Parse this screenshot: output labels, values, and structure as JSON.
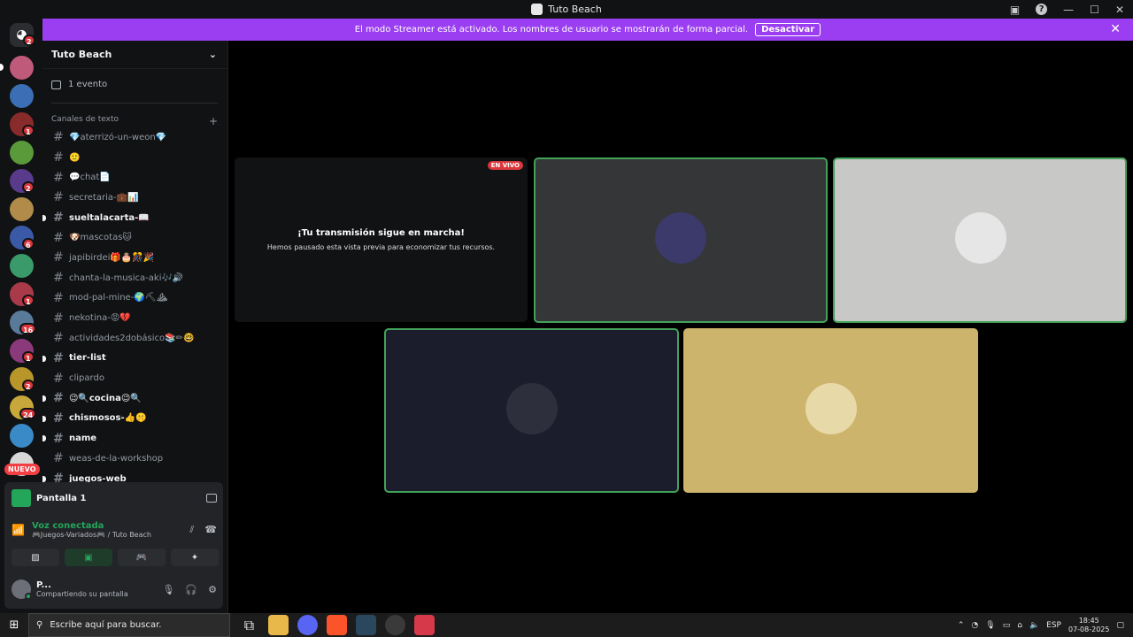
{
  "window": {
    "title": "Tuto Beach"
  },
  "banner": {
    "text": "El modo Streamer está activado. Los nombres de usuario se mostrarán de forma parcial.",
    "button": "Desactivar"
  },
  "rail": {
    "badges": [
      "2",
      "1",
      "2",
      "6",
      "1",
      "16",
      "1",
      "2",
      "24"
    ],
    "new_label": "NUEVO"
  },
  "server": {
    "name": "Tuto Beach",
    "events": "1 evento",
    "category": "Canales de texto",
    "channels": [
      {
        "name": "💎aterrizó-un-weon💎",
        "bold": false
      },
      {
        "name": "🙂",
        "bold": false
      },
      {
        "name": "💬chat📄",
        "bold": false
      },
      {
        "name": "secretaria-💼📊",
        "bold": false
      },
      {
        "name": "sueltalacarta-📖",
        "bold": true
      },
      {
        "name": "🐶mascotas🐱",
        "bold": false
      },
      {
        "name": "japibirdei🎁🎂🎊🎉",
        "bold": false
      },
      {
        "name": "chanta-la-musica-aki🎶🔊",
        "bold": false
      },
      {
        "name": "mod-pal-mine-🌍⛏⛰",
        "bold": false
      },
      {
        "name": "nekotina-😡💔",
        "bold": false
      },
      {
        "name": "actividades2dobásico📚✏🤓",
        "bold": false
      },
      {
        "name": "tier-list",
        "bold": true
      },
      {
        "name": "clipardo",
        "bold": false
      },
      {
        "name": "😉🔍cocina😉🔍",
        "bold": true
      },
      {
        "name": "chismosos-👍🤫",
        "bold": true
      },
      {
        "name": "name",
        "bold": true
      },
      {
        "name": "weas-de-la-workshop",
        "bold": false
      },
      {
        "name": "juegos-web",
        "bold": true
      }
    ]
  },
  "panel": {
    "screen_name": "Pantalla 1",
    "voice_title": "Voz conectada",
    "voice_sub": "🎮Juegos-Variados🎮 / Tuto Beach",
    "user_name": "P...",
    "user_status": "Compartiendo su pantalla"
  },
  "stage": {
    "live_badge": "EN VIVO",
    "live_title": "¡Tu transmisión sigue en marcha!",
    "live_sub": "Hemos pausado esta vista previa para economizar tus recursos.",
    "tile_colors": [
      "#343638",
      "#c8c8c6",
      "#1b1d2c",
      "#cdb46c"
    ]
  },
  "taskbar": {
    "search_placeholder": "Escribe aquí para buscar.",
    "language": "ESP",
    "time": "18:45",
    "date": "07-08-2025"
  }
}
